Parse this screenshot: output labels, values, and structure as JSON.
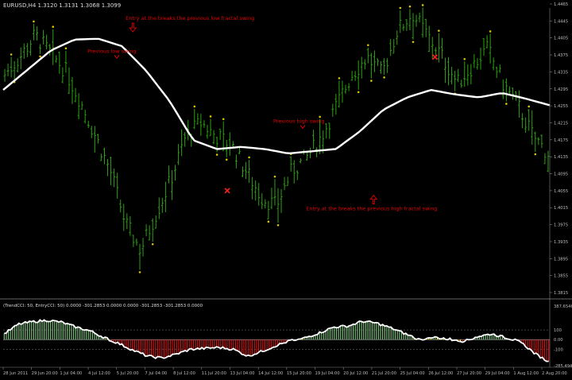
{
  "symbol_header": "EURUSD,H4  1.3120 1.3131 1.3068 1.3099",
  "indicator_header": "(TrendCCI: 50, EntryCCI: 50) 0.0000 -301.2853 0.0000 0.0000 -301.2853 -301.2853 0.0000",
  "colors": {
    "background": "#000000",
    "bar_up": "#2ea012",
    "fractal_dot": "#d9c200",
    "moving_average": "#ffffff",
    "annotation_text": "#e00000",
    "cci_positive": "#7fbf7f",
    "cci_negative": "#c81414",
    "cci_trigger": "#ffff00",
    "grid": "#666666",
    "axis_text": "#bbbbbb"
  },
  "chart_data": [
    {
      "type": "line",
      "title": "EURUSD,H4",
      "subtitle": "1.3120 1.3131 1.3068 1.3099",
      "y_ticks": [
        "1.4465",
        "1.4445",
        "1.4405",
        "1.4375",
        "1.4335",
        "1.4295",
        "1.4255",
        "1.4215",
        "1.4175",
        "1.4135",
        "1.4095",
        "1.4055",
        "1.4015",
        "1.3975",
        "1.3935",
        "1.3895",
        "1.3855",
        "1.3815"
      ],
      "ylim": [
        1.3815,
        1.4465
      ],
      "x_tick_labels": [
        "28 Jun 2011",
        "29 Jun 20:00",
        "1 Jul 04:00",
        "4 Jul 12:00",
        "5 Jul 20:00",
        "7 Jul 04:00",
        "8 Jul 12:00",
        "11 Jul 20:00",
        "13 Jul 04:00",
        "14 Jul 12:00",
        "15 Jul 20:00",
        "19 Jul 04:00",
        "20 Jul 12:00",
        "21 Jul 20:00",
        "25 Jul 04:00",
        "26 Jul 12:00",
        "27 Jul 20:00",
        "29 Jul 04:00",
        "1 Aug 12:00",
        "2 Aug 20:00"
      ],
      "price_path": [
        1.432,
        1.436,
        1.441,
        1.437,
        1.433,
        1.426,
        1.418,
        1.41,
        1.398,
        1.392,
        1.4,
        1.408,
        1.418,
        1.421,
        1.418,
        1.416,
        1.41,
        1.404,
        1.402,
        1.41,
        1.413,
        1.418,
        1.425,
        1.432,
        1.436,
        1.432,
        1.442,
        1.446,
        1.441,
        1.436,
        1.43,
        1.434,
        1.438,
        1.43,
        1.425,
        1.418,
        1.414
      ],
      "series": [
        {
          "values": [
            1.4285,
            1.433,
            1.4375,
            1.44,
            1.4402,
            1.4385,
            1.433,
            1.426,
            1.417,
            1.415,
            1.4155,
            1.415,
            1.414,
            1.4145,
            1.415,
            1.419,
            1.424,
            1.4268,
            1.4285,
            1.4275,
            1.4268,
            1.4278,
            1.4265,
            1.425
          ]
        }
      ],
      "annotations": [
        {
          "text": "Entry at the breaks the previous low fractal swing",
          "x_index": 0.23,
          "y": 1.4445,
          "arrow": "down"
        },
        {
          "text": "Previous low swing",
          "x_index": 0.16,
          "y": 1.437,
          "arrow": "down-small"
        },
        {
          "text": "Previous high swing",
          "x_index": 0.5,
          "y": 1.421,
          "arrow": "down-small"
        },
        {
          "text": "Entry at the breaks the previous high fractal swing",
          "x_index": 0.56,
          "y": 1.401,
          "arrow": "up"
        }
      ],
      "markers": [
        {
          "x_index": 0.41,
          "y": 1.4055,
          "shape": "x"
        },
        {
          "x_index": 0.79,
          "y": 1.436,
          "shape": "x"
        }
      ]
    },
    {
      "type": "bar",
      "title": "TrendCCI: 50, EntryCCI: 50",
      "y_ticks": [
        "387.6546",
        "100",
        "0.00",
        "-100",
        "-285.4940"
      ],
      "ylim": [
        -285.494,
        387.6546
      ],
      "values_path": [
        60,
        160,
        185,
        200,
        180,
        130,
        90,
        20,
        -40,
        -110,
        -170,
        -190,
        -150,
        -100,
        -90,
        -80,
        -100,
        -170,
        -120,
        -60,
        -10,
        20,
        70,
        130,
        140,
        190,
        170,
        120,
        60,
        0,
        20,
        10,
        -20,
        30,
        60,
        20,
        -20,
        -140,
        -230
      ]
    }
  ]
}
